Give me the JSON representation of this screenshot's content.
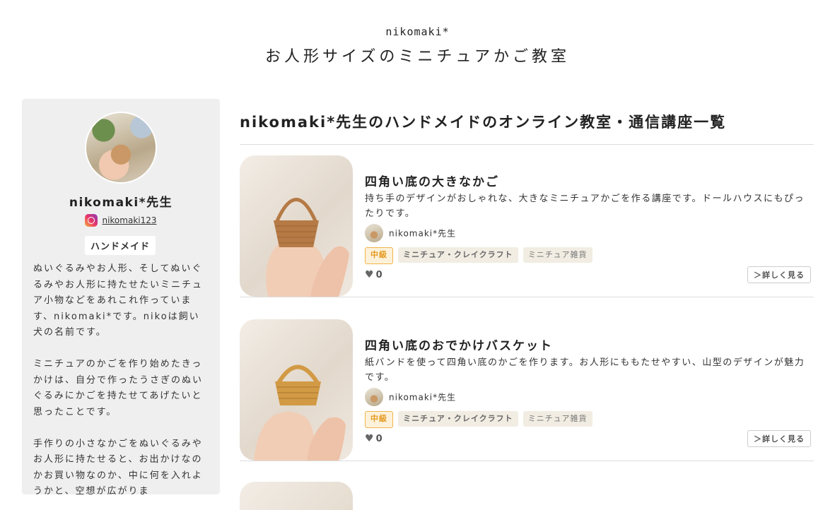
{
  "header": {
    "brand_small": "nikomaki*",
    "brand_title": "お人形サイズのミニチュアかご教室"
  },
  "sidebar": {
    "teacher_name": "nikomaki*先生",
    "instagram_handle": "nikomaki123",
    "category": "ハンドメイド",
    "bio": "ぬいぐるみやお人形、そしてぬいぐるみやお人形に持たせたいミニチュア小物などをあれこれ作っています、nikomaki*です。nikoは飼い犬の名前です。\n\nミニチュアのかごを作り始めたきっかけは、自分で作ったうさぎのぬいぐるみにかごを持たせてあげたいと思ったことです。\n\n手作りの小さなかごをぬいぐるみやお人形に持たせると、お出かけなのかお買い物なのか、中に何を入れようかと、空想が広がりま"
  },
  "main": {
    "heading": "nikomaki*先生のハンドメイドのオンライン教室・通信講座一覧",
    "courses": [
      {
        "title": "四角い底の大きなかご",
        "description": "持ち手のデザインがおしゃれな、大きなミニチュアかごを作る講座です。ドールハウスにもぴったりです。",
        "author": "nikomaki*先生",
        "level": "中級",
        "category": "ミニチュア・クレイクラフト",
        "subcategory": "ミニチュア雑貨",
        "likes": "0",
        "details_label": "＞詳しく見る",
        "basket_color": "#b57a45"
      },
      {
        "title": "四角い底のおでかけバスケット",
        "description": "紙バンドを使って四角い底のかごを作ります。お人形にももたせやすい、山型のデザインが魅力です。",
        "author": "nikomaki*先生",
        "level": "中級",
        "category": "ミニチュア・クレイクラフト",
        "subcategory": "ミニチュア雑貨",
        "likes": "0",
        "details_label": "＞詳しく見る",
        "basket_color": "#d29a45"
      }
    ]
  }
}
